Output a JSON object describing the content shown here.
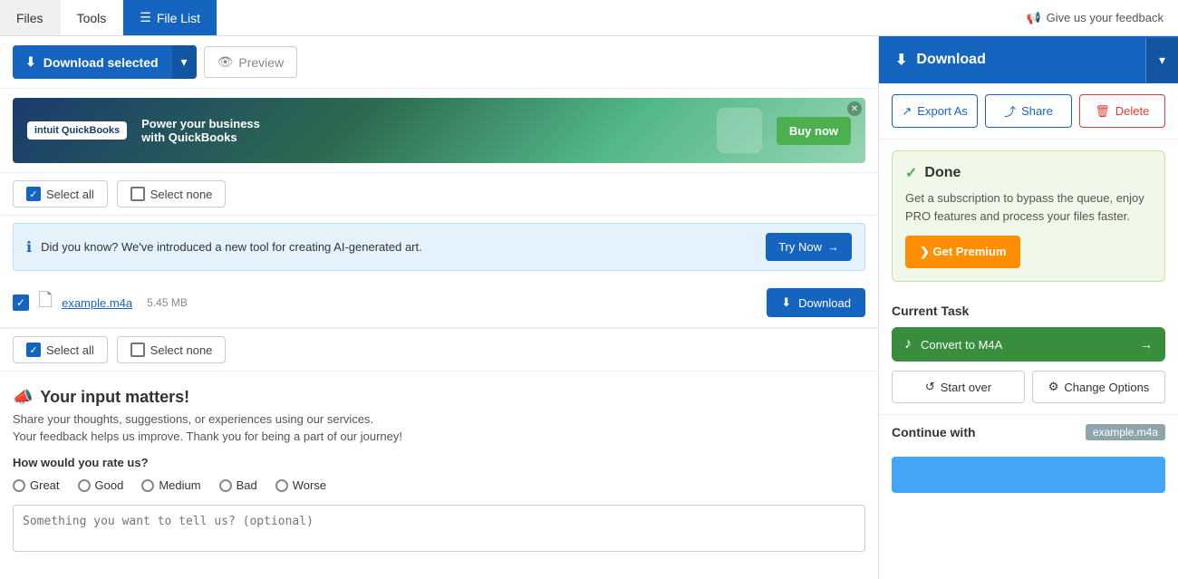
{
  "nav": {
    "files_label": "Files",
    "tools_label": "Tools",
    "filelist_label": "File List",
    "feedback_label": "Give us your feedback"
  },
  "toolbar": {
    "download_selected_label": "Download selected",
    "preview_label": "Preview"
  },
  "select_bar_top": {
    "select_all_label": "Select all",
    "select_none_label": "Select none"
  },
  "info_bar": {
    "text": "Did you know? We've introduced a new tool for creating AI-generated art.",
    "try_now_label": "Try Now"
  },
  "file": {
    "name": "example.m4a",
    "size": "5.45 MB",
    "download_label": "Download"
  },
  "select_bar_bottom": {
    "select_all_label": "Select all",
    "select_none_label": "Select none"
  },
  "feedback": {
    "title": "Your input matters!",
    "megaphone_icon": "📣",
    "subtitle1": "Share your thoughts, suggestions, or experiences using our services.",
    "subtitle2": "Your feedback helps us improve. Thank you for being a part of our journey!",
    "rating_label": "How would you rate us?",
    "options": [
      "Great",
      "Good",
      "Medium",
      "Bad",
      "Worse"
    ],
    "textarea_placeholder": "Something you want to tell us? (optional)"
  },
  "right_panel": {
    "download_label": "Download",
    "export_label": "Export As",
    "share_label": "Share",
    "delete_label": "Delete",
    "done_title": "Done",
    "done_check": "✓",
    "done_text": "Get a subscription to bypass the queue, enjoy PRO features and process your files faster.",
    "premium_label": "❯ Get Premium",
    "current_task_label": "Current Task",
    "task_name": "Convert to M4A",
    "start_over_label": "Start over",
    "change_options_label": "Change Options",
    "continue_label": "Continue with",
    "continue_file": "example.m4a",
    "download_icon": "⬇",
    "music_icon": "♪"
  }
}
